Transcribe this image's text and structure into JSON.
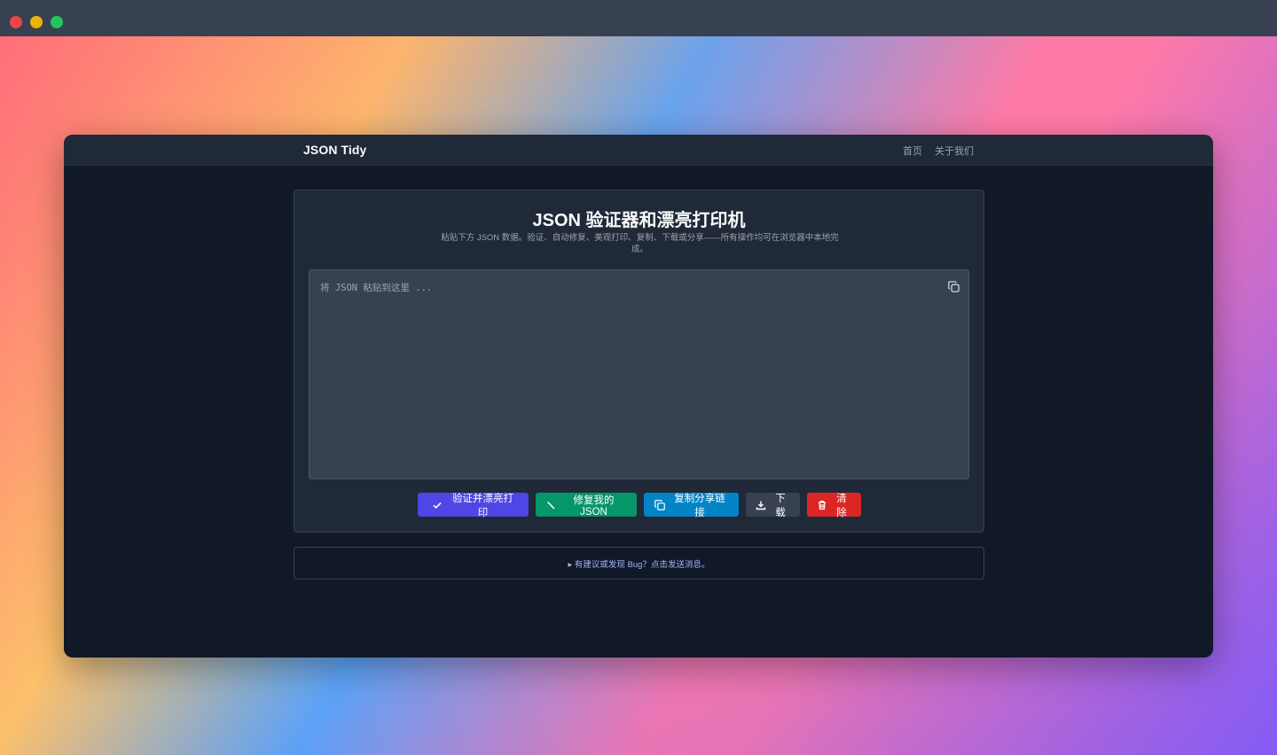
{
  "app": {
    "brand": "JSON Tidy",
    "nav": [
      {
        "label": "首页"
      },
      {
        "label": "关于我们"
      }
    ]
  },
  "main": {
    "title": "JSON 验证器和漂亮打印机",
    "subtitle": "粘贴下方 JSON 数据。验证、自动修复、美观打印、复制、下载或分享——所有操作均可在浏览器中本地完成。",
    "editor": {
      "value": "",
      "placeholder": "将 JSON 粘贴到这里 ..."
    },
    "buttons": {
      "validate": "验证并漂亮打印",
      "repair": "修复我的 JSON",
      "share": "复制分享链接",
      "download": "下载",
      "clear": "清除"
    },
    "feedback": "▸ 有建议或发现 Bug？点击发送消息。"
  },
  "colors": {
    "validate": "#4f46e5",
    "repair": "#059669",
    "share": "#0284c7",
    "download": "#374151",
    "clear": "#dc2626"
  },
  "icons": {
    "validate": "check-icon",
    "repair": "wrench-icon",
    "share": "copy-icon",
    "download": "download-icon",
    "clear": "trash-icon",
    "editor_copy": "copy-icon"
  }
}
